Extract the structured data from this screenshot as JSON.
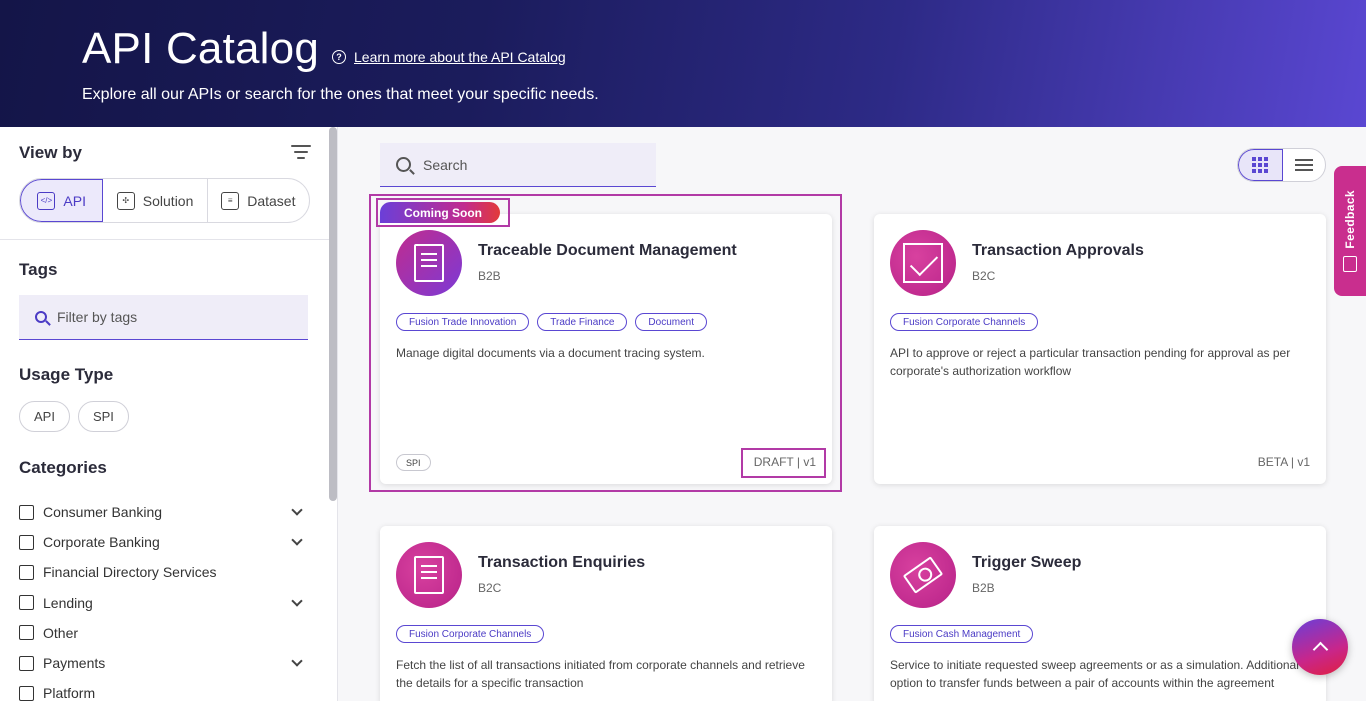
{
  "header": {
    "title": "API Catalog",
    "learn_more": "Learn more about the API Catalog",
    "subtitle": "Explore all our APIs or search for the ones that meet your specific needs."
  },
  "sidebar": {
    "view_by_title": "View by",
    "view_options": [
      {
        "label": "API",
        "icon": "code-icon",
        "active": true
      },
      {
        "label": "Solution",
        "icon": "puzzle-icon",
        "active": false
      },
      {
        "label": "Dataset",
        "icon": "database-icon",
        "active": false
      }
    ],
    "tags_title": "Tags",
    "tags_placeholder": "Filter by tags",
    "usage_type_title": "Usage Type",
    "usage_types": [
      "API",
      "SPI"
    ],
    "categories_title": "Categories",
    "categories": [
      {
        "label": "Consumer Banking",
        "expandable": true
      },
      {
        "label": "Corporate Banking",
        "expandable": true
      },
      {
        "label": "Financial Directory Services",
        "expandable": false
      },
      {
        "label": "Lending",
        "expandable": true
      },
      {
        "label": "Other",
        "expandable": false
      },
      {
        "label": "Payments",
        "expandable": true
      },
      {
        "label": "Platform",
        "expandable": false
      }
    ]
  },
  "main": {
    "search_placeholder": "Search",
    "coming_soon": "Coming Soon",
    "cards": [
      {
        "title": "Traceable Document Management",
        "sub": "B2B",
        "tags": [
          "Fusion Trade Innovation",
          "Trade Finance",
          "Document"
        ],
        "desc": "Manage digital documents via a document tracing system.",
        "badge": "SPI",
        "status": "DRAFT | v1"
      },
      {
        "title": "Transaction Approvals",
        "sub": "B2C",
        "tags": [
          "Fusion Corporate Channels"
        ],
        "desc": "API to approve or reject a particular transaction pending for approval as per corporate's authorization workflow",
        "badge": "",
        "status": "BETA | v1"
      },
      {
        "title": "Transaction Enquiries",
        "sub": "B2C",
        "tags": [
          "Fusion Corporate Channels"
        ],
        "desc": "Fetch the list of all transactions initiated from corporate channels and retrieve the details for a specific transaction",
        "badge": "",
        "status": ""
      },
      {
        "title": "Trigger Sweep",
        "sub": "B2B",
        "tags": [
          "Fusion Cash Management"
        ],
        "desc": "Service to initiate requested sweep agreements or as a simulation. Additional option to transfer funds between a pair of accounts within the agreement",
        "badge": "",
        "status": ""
      }
    ]
  },
  "feedback": {
    "label": "Feedback"
  },
  "colors": {
    "accent": "#5a47d2",
    "magenta": "#c12b8f",
    "highlight": "#b23aa6"
  }
}
